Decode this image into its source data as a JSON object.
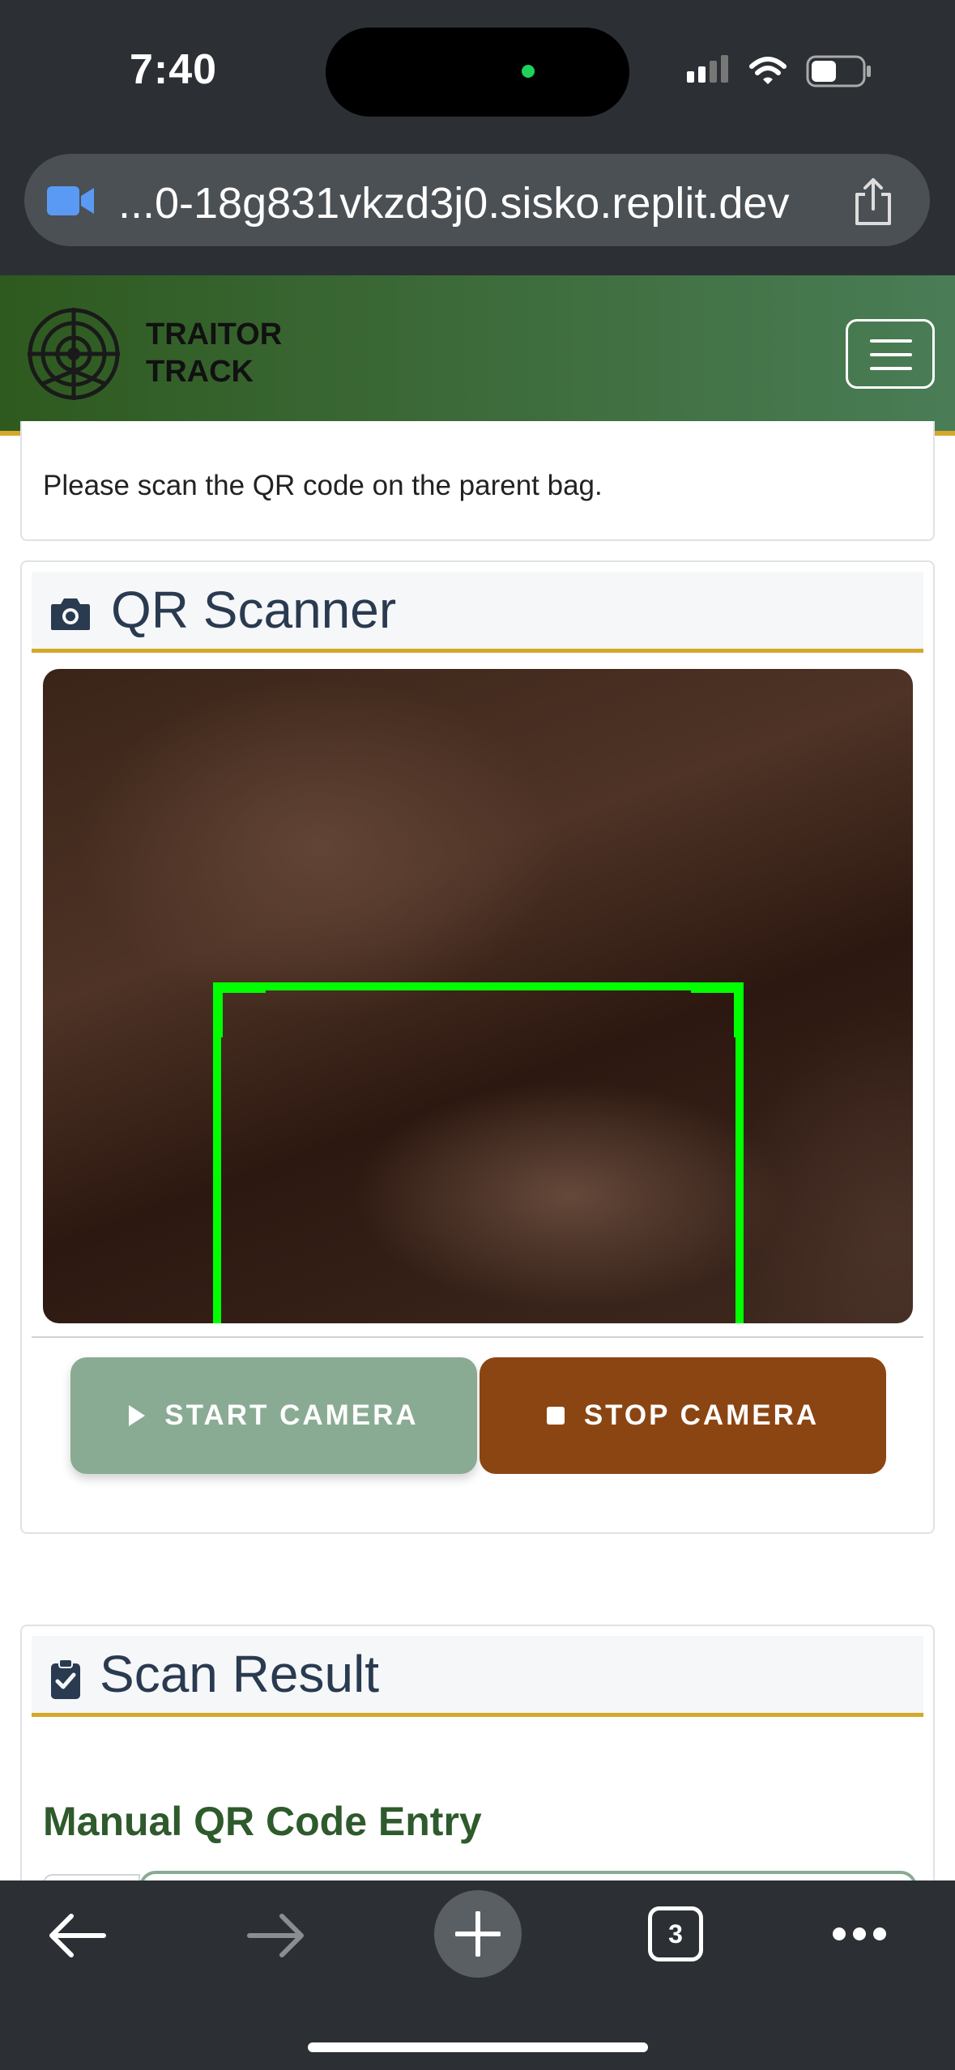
{
  "status_bar": {
    "time": "7:40",
    "camera_indicator_color": "#1fd15a"
  },
  "browser": {
    "url": "...0-18g831vkzd3j0.sisko.replit.dev",
    "open_tabs": "3"
  },
  "app": {
    "brand_line1": "TRAITOR",
    "brand_line2": "TRACK",
    "header_colors": [
      "#2e5a1f",
      "#4a7d56"
    ],
    "accent_color": "#d4a82a"
  },
  "instruction_card": {
    "text": "Please scan the QR code on the parent bag."
  },
  "scanner": {
    "title": "QR Scanner",
    "frame_color": "#00ff00",
    "start_label": "START CAMERA",
    "stop_label": "STOP CAMERA",
    "start_color": "#8aab93",
    "stop_color": "#8b4513"
  },
  "result": {
    "title": "Scan Result",
    "manual_title": "Manual QR Code Entry"
  },
  "icons": {
    "status": [
      "signal-icon",
      "wifi-icon",
      "battery-icon"
    ],
    "browser": [
      "camera-active-icon",
      "share-icon"
    ],
    "toolbar": [
      "back-icon",
      "forward-icon",
      "new-tab-icon",
      "tabs-icon",
      "more-icon"
    ]
  }
}
